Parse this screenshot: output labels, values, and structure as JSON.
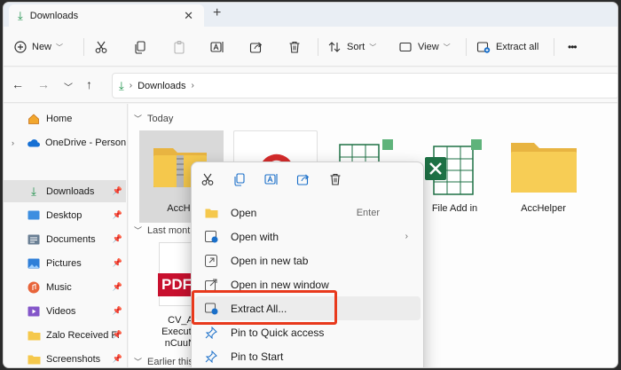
{
  "tabs": [
    {
      "title": "Downloads"
    }
  ],
  "toolbar": {
    "new_label": "New",
    "sort_label": "Sort",
    "view_label": "View",
    "extract_label": "Extract all",
    "more_label": "•••"
  },
  "address": {
    "crumb": "Downloads"
  },
  "sidebar": {
    "items": [
      {
        "label": "Home"
      },
      {
        "label": "OneDrive - Persona"
      },
      {
        "label": "Downloads"
      },
      {
        "label": "Desktop"
      },
      {
        "label": "Documents"
      },
      {
        "label": "Pictures"
      },
      {
        "label": "Music"
      },
      {
        "label": "Videos"
      },
      {
        "label": "Zalo Received Fi"
      },
      {
        "label": "Screenshots"
      }
    ]
  },
  "content": {
    "groups": [
      "Today",
      "Last month",
      "Earlier this"
    ],
    "tiles": [
      {
        "name": "AccHe"
      },
      {
        "name": "File Add in"
      },
      {
        "name": "AccHelper"
      }
    ],
    "pdf_badge": "PDF",
    "pdf_tile_lines": [
      "CV_Acc",
      "Executive_",
      "nCuuNga"
    ]
  },
  "context_menu": {
    "items": [
      {
        "label": "Open",
        "shortcut": "Enter"
      },
      {
        "label": "Open with"
      },
      {
        "label": "Open in new tab"
      },
      {
        "label": "Open in new window"
      },
      {
        "label": "Extract All..."
      },
      {
        "label": "Pin to Quick access"
      },
      {
        "label": "Pin to Start"
      }
    ]
  },
  "colors": {
    "accent": "#1a8f48",
    "highlight": "#e8391c",
    "folder": "#f5c84c",
    "excel": "#1e7145"
  }
}
